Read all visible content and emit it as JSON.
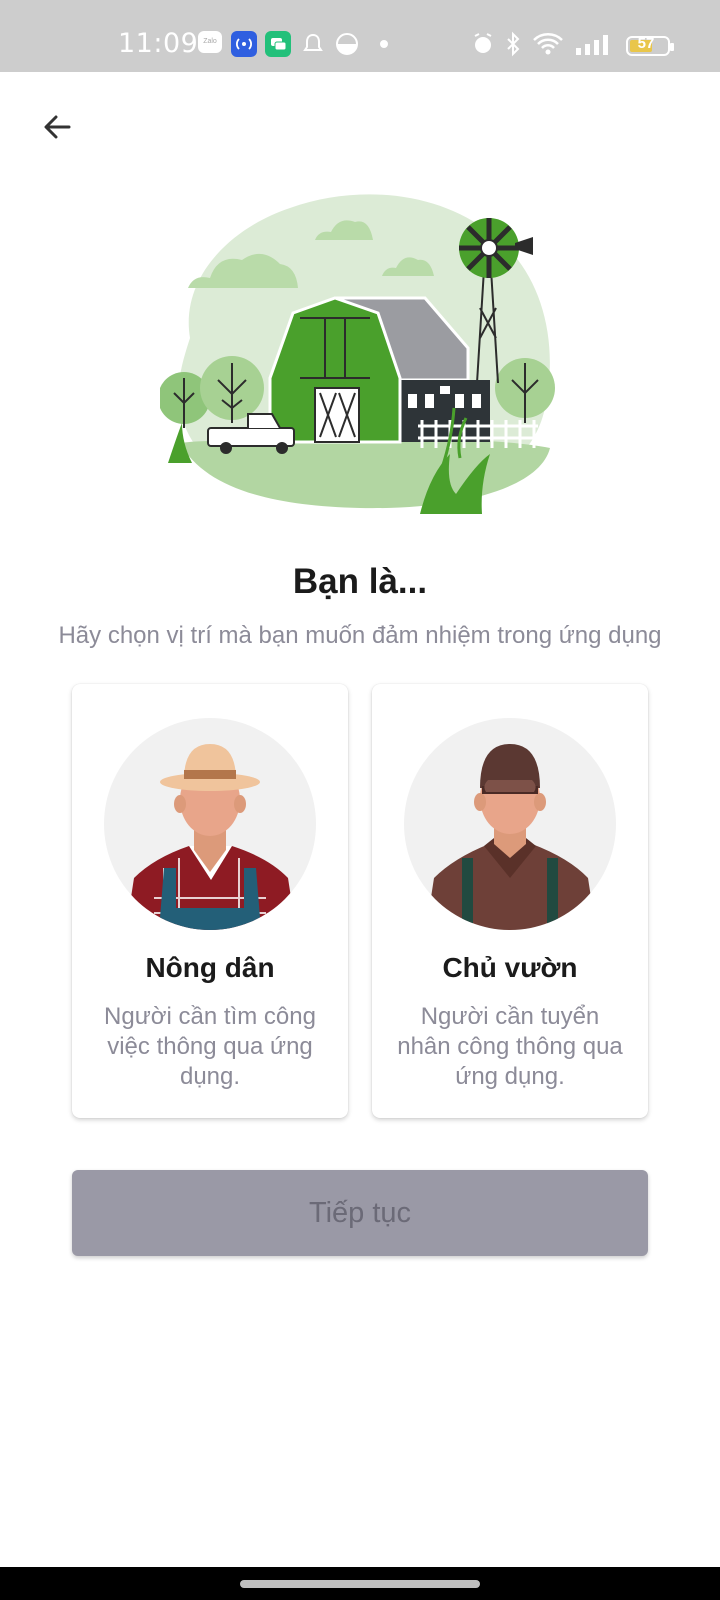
{
  "status_bar": {
    "time": "11:09",
    "battery_level": "57",
    "icons": [
      "zalo-icon",
      "hotspot-icon",
      "chat-icon",
      "bell-icon",
      "round-icon",
      "dot-icon",
      "alarm-icon",
      "bluetooth-icon",
      "wifi-icon",
      "signal-icon",
      "battery-icon"
    ]
  },
  "header": {
    "back_icon": "arrow-left-icon"
  },
  "hero": {
    "illustration": "farm-barn-windmill-illustration"
  },
  "content": {
    "title": "Bạn là...",
    "subtitle": "Hãy chọn vị trí mà bạn muốn đảm nhiệm trong ứng dụng"
  },
  "roles": [
    {
      "name": "Nông dân",
      "description": "Người cần tìm công việc thông qua ứng dụng.",
      "avatar": "farmer-avatar"
    },
    {
      "name": "Chủ vườn",
      "description": "Người cần tuyển nhân công thông qua ứng dụng.",
      "avatar": "garden-owner-avatar"
    }
  ],
  "actions": {
    "continue_label": "Tiếp tục",
    "continue_enabled": false
  },
  "colors": {
    "accent_green": "#4aa02c",
    "disabled_button": "#9a99a6",
    "muted_text": "#8c8b98"
  }
}
